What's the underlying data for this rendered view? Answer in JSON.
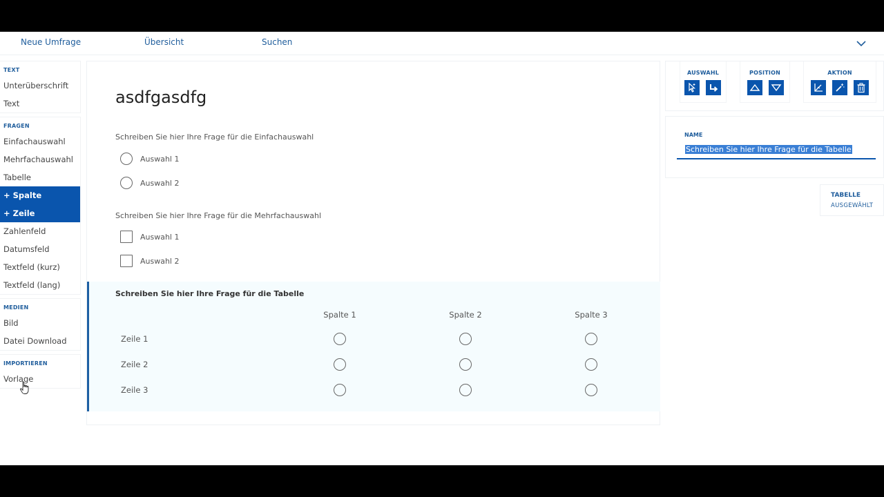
{
  "nav": {
    "new_survey": "Neue Umfrage",
    "overview": "Übersicht",
    "search": "Suchen"
  },
  "sidebar": {
    "text": {
      "heading": "TEXT",
      "items": [
        "Unterüberschrift",
        "Text"
      ]
    },
    "questions": {
      "heading": "FRAGEN",
      "items": [
        "Einfachauswahl",
        "Mehrfachauswahl",
        "Tabelle",
        "+ Spalte",
        "+ Zeile",
        "Zahlenfeld",
        "Datumsfeld",
        "Textfeld (kurz)",
        "Textfeld (lang)"
      ],
      "active": [
        "+ Spalte",
        "+ Zeile"
      ]
    },
    "media": {
      "heading": "MEDIEN",
      "items": [
        "Bild",
        "Datei Download"
      ]
    },
    "import": {
      "heading": "IMPORTIEREN",
      "items": [
        "Vorlage"
      ]
    }
  },
  "survey": {
    "title": "asdfgasdfg",
    "single_choice": {
      "question": "Schreiben Sie hier Ihre Frage für die Einfachauswahl",
      "options": [
        "Auswahl 1",
        "Auswahl 2"
      ]
    },
    "multi_choice": {
      "question": "Schreiben Sie hier Ihre Frage für die Mehrfachauswahl",
      "options": [
        "Auswahl 1",
        "Auswahl 2"
      ]
    },
    "table": {
      "question": "Schreiben Sie hier Ihre Frage für die Tabelle",
      "columns": [
        "Spalte 1",
        "Spalte 2",
        "Spalte 3"
      ],
      "rows": [
        "Zeile 1",
        "Zeile 2",
        "Zeile 3"
      ]
    }
  },
  "toolbar": {
    "selection": "AUSWAHL",
    "position": "POSITION",
    "action": "AKTION"
  },
  "properties": {
    "name_label": "NAME",
    "name_value": "Schreiben Sie hier Ihre Frage für die Tabelle"
  },
  "selected_tag": {
    "title": "TABELLE",
    "subtitle": "AUSGEWÄHLT"
  },
  "colors": {
    "accent": "#0a55ad",
    "link": "#1f5d9c",
    "selection": "#3a7fd5",
    "table_bg": "#f5fcfe"
  },
  "icons": {
    "selection": [
      "select-pointer-icon",
      "enter-arrow-icon"
    ],
    "position": [
      "move-up-icon",
      "move-down-icon"
    ],
    "action": [
      "angle-axis-icon",
      "magic-wand-icon",
      "trash-icon"
    ]
  }
}
